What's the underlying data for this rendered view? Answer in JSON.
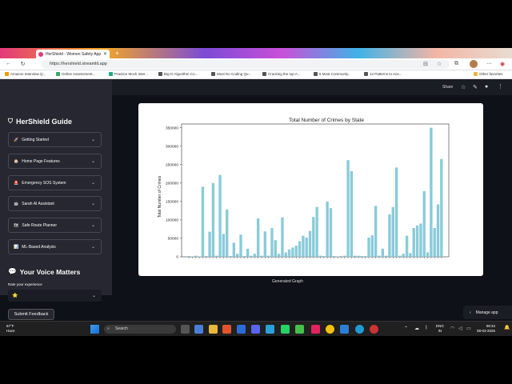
{
  "browser": {
    "tabs": [
      {
        "title": "HerShield - Women Safety App"
      },
      {
        "title": "Your Repositories"
      }
    ],
    "url": "https://hershield.streamlit.app",
    "bookmarks": [
      "Amazon Interview Q...",
      "Online Assessment...",
      "Practice Mock Inter...",
      "Big-O Algorithm Co...",
      "Must Do Coding Qu...",
      "Cracking the top A...",
      "5 Most Commonly...",
      "14 Patterns to Ace..."
    ],
    "other_favorites": "Other favorites"
  },
  "toolbar": {
    "share": "Share"
  },
  "sidebar": {
    "title": "HerShield Guide",
    "title_icon": "shield-icon",
    "items": [
      {
        "label": "Getting Started",
        "icon": "rocket-icon"
      },
      {
        "label": "Home Page Features",
        "icon": "house-icon"
      },
      {
        "label": "Emergency SOS System",
        "icon": "siren-icon"
      },
      {
        "label": "Sarah AI Assistant",
        "icon": "bot-icon"
      },
      {
        "label": "Safe Route Planner",
        "icon": "map-icon"
      },
      {
        "label": "ML-Based Analysis",
        "icon": "chart-icon"
      }
    ],
    "voice_title": "Your Voice Matters",
    "rate_label": "Rate your experience",
    "rate_value": "⭐",
    "submit_label": "Submit Feedback"
  },
  "main": {
    "generated_label": "Generated Graph",
    "manage_app": "Manage app"
  },
  "chart_data": {
    "type": "bar",
    "title": "Total Number of Crimes by State",
    "xlabel": "",
    "ylabel": "Total Number of Crimes",
    "ylim": [
      0,
      360000
    ],
    "yticks": [
      0,
      50000,
      100000,
      150000,
      200000,
      250000,
      300000,
      350000
    ],
    "color": "#89cbd9",
    "values": [
      2000,
      1000,
      3000,
      1000,
      190000,
      2000,
      68000,
      200000,
      3000,
      222000,
      62000,
      128000,
      2000,
      38000,
      8000,
      60000,
      2000,
      22000,
      3000,
      8000,
      104000,
      3000,
      69000,
      3000,
      78000,
      45000,
      8000,
      107000,
      12000,
      20000,
      25000,
      30000,
      42000,
      57000,
      52000,
      70000,
      108000,
      135000,
      3000,
      2000,
      150000,
      132000,
      2000,
      1000,
      2000,
      3000,
      262000,
      232000,
      3000,
      3000,
      2000,
      2000,
      52000,
      58000,
      138000,
      3000,
      22000,
      3000,
      115000,
      135000,
      242000,
      3000,
      8000,
      57000,
      10000,
      78000,
      85000,
      90000,
      178000,
      12000,
      350000,
      78000,
      142000,
      265000
    ]
  },
  "taskbar": {
    "weather_temp": "67°F",
    "weather_desc": "Haze",
    "search": "Search",
    "lang_top": "ENG",
    "lang_bottom": "IN",
    "time": "08:34",
    "date": "08-03-2025"
  }
}
